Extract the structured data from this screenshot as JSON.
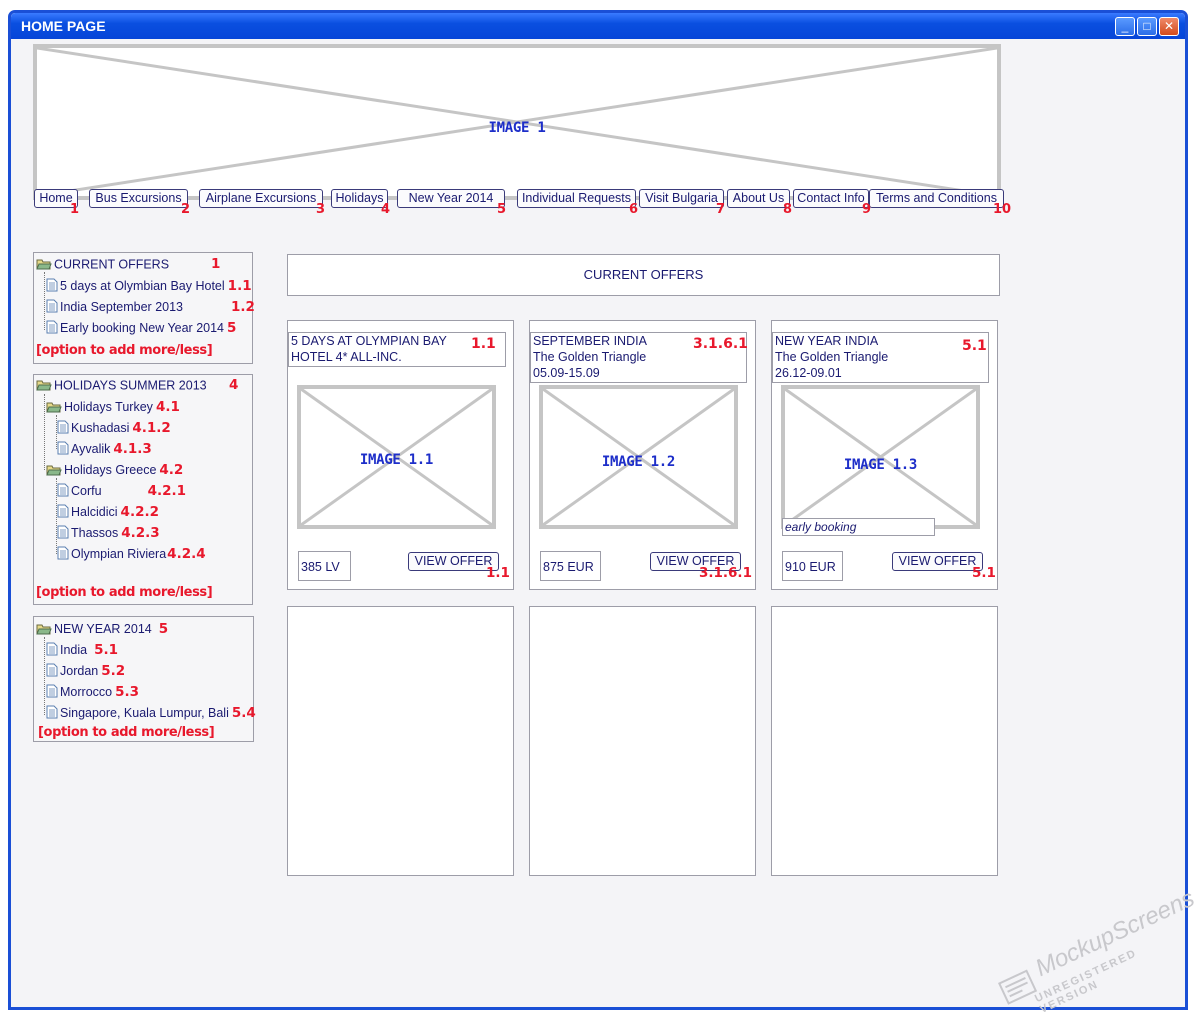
{
  "window": {
    "title": "HOME PAGE",
    "minimize": "_",
    "maximize": "□",
    "close": "✕"
  },
  "header_image": {
    "label": "IMAGE 1"
  },
  "nav": [
    {
      "label": "Home",
      "num": "1"
    },
    {
      "label": "Bus Excursions",
      "num": "2"
    },
    {
      "label": "Airplane Excursions",
      "num": "3"
    },
    {
      "label": "Holidays",
      "num": "4"
    },
    {
      "label": "New Year 2014",
      "num": "5"
    },
    {
      "label": "Individual Requests",
      "num": "6"
    },
    {
      "label": "Visit Bulgaria",
      "num": "7"
    },
    {
      "label": "About Us",
      "num": "8"
    },
    {
      "label": "Contact Info",
      "num": "9"
    },
    {
      "label": "Terms and Conditions",
      "num": "10"
    }
  ],
  "trees": [
    {
      "title": "CURRENT OFFERS",
      "num": "1",
      "items": [
        {
          "label": "5 days at Olymbian Bay Hotel",
          "num": "1.1"
        },
        {
          "label": "India September 2013",
          "num": "1.2"
        },
        {
          "label": "Early booking New Year 2014",
          "num": "5"
        }
      ],
      "more": "[option to add more/less]"
    },
    {
      "title": "HOLIDAYS SUMMER 2013",
      "num": "4",
      "groups": [
        {
          "label": "Holidays Turkey",
          "num": "4.1",
          "items": [
            {
              "label": "Kushadasi",
              "num": "4.1.2"
            },
            {
              "label": "Ayvalik",
              "num": "4.1.3"
            }
          ]
        },
        {
          "label": "Holidays Greece",
          "num": "4.2",
          "items": [
            {
              "label": "Corfu",
              "num": "4.2.1"
            },
            {
              "label": "Halcidici",
              "num": "4.2.2"
            },
            {
              "label": "Thassos",
              "num": "4.2.3"
            },
            {
              "label": "Olympian Riviera",
              "num": "4.2.4"
            }
          ]
        }
      ],
      "more": "[option to add more/less]"
    },
    {
      "title": "NEW YEAR 2014",
      "num": "5",
      "items": [
        {
          "label": "India",
          "num": "5.1"
        },
        {
          "label": "Jordan",
          "num": "5.2"
        },
        {
          "label": "Morrocco",
          "num": "5.3"
        },
        {
          "label": "Singapore, Kuala Lumpur, Bali",
          "num": "5.4"
        }
      ],
      "more": "[option to add more/less]"
    }
  ],
  "main": {
    "heading": "CURRENT OFFERS",
    "offers": [
      {
        "line1": "5 DAYS AT OLYMPIAN BAY",
        "line2": "HOTEL 4* ALL-INC.",
        "line3": "",
        "num": "1.1",
        "image": "IMAGE 1.1",
        "tag": "",
        "price": "385 LV",
        "button": "VIEW OFFER",
        "btn_num": "1.1"
      },
      {
        "line1": "SEPTEMBER INDIA",
        "line2": "The Golden Triangle",
        "line3": "05.09-15.09",
        "num": "3.1.6.1",
        "image": "IMAGE 1.2",
        "tag": "",
        "price": "875 EUR",
        "button": "VIEW OFFER",
        "btn_num": "3.1.6.1"
      },
      {
        "line1": "NEW YEAR INDIA",
        "line2": "The Golden Triangle",
        "line3": "26.12-09.01",
        "num": "5.1",
        "image": "IMAGE 1.3",
        "tag": "early booking",
        "price": "910 EUR",
        "button": "VIEW OFFER",
        "btn_num": "5.1"
      }
    ]
  },
  "watermark": {
    "line1": "MockupScreens",
    "line2": "UNREGISTERED VERSION"
  }
}
